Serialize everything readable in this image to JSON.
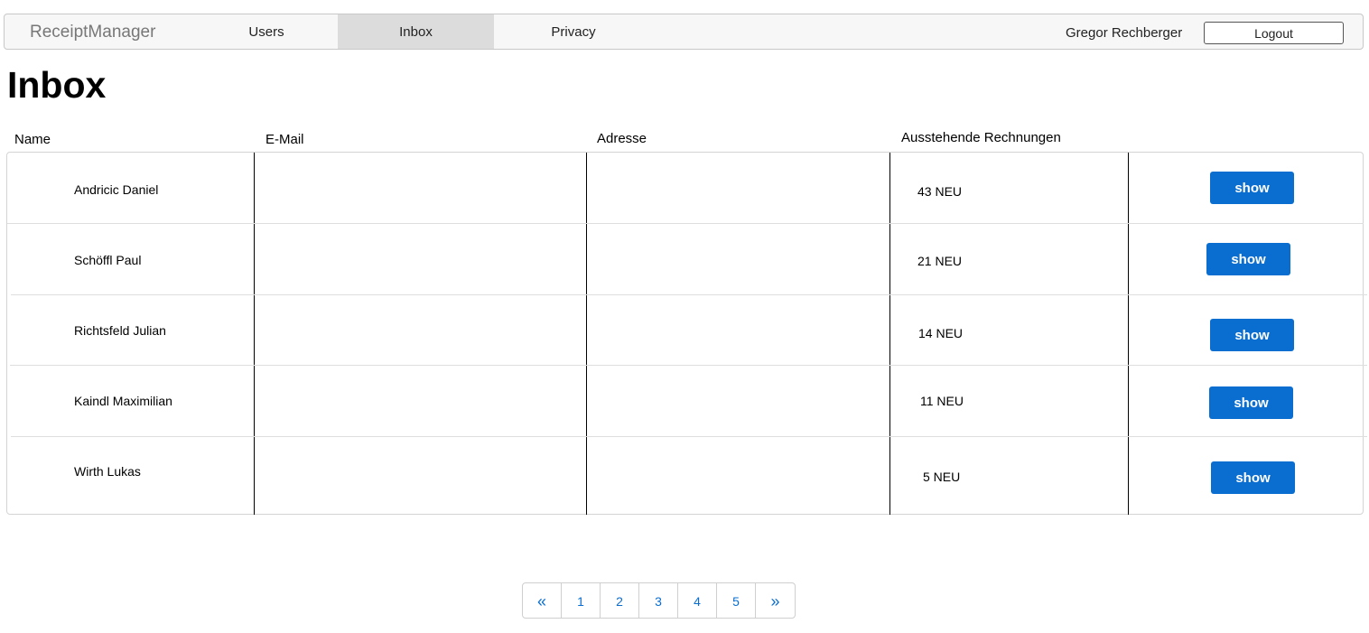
{
  "navbar": {
    "brand": "ReceiptManager",
    "items": [
      {
        "label": "Users",
        "active": false
      },
      {
        "label": "Inbox",
        "active": true
      },
      {
        "label": "Privacy",
        "active": false
      }
    ],
    "user_name": "Gregor Rechberger",
    "logout_label": "Logout"
  },
  "page": {
    "title": "Inbox"
  },
  "table": {
    "columns": [
      "Name",
      "E-Mail",
      "Adresse",
      "Ausstehende Rechnungen"
    ],
    "rows": [
      {
        "name": "Andricic Daniel",
        "email": "",
        "address": "",
        "pending": "43 NEU",
        "action": "show"
      },
      {
        "name": "Schöffl Paul",
        "email": "",
        "address": "",
        "pending": "21 NEU",
        "action": "show"
      },
      {
        "name": "Richtsfeld Julian",
        "email": "",
        "address": "",
        "pending": "14 NEU",
        "action": "show"
      },
      {
        "name": "Kaindl Maximilian",
        "email": "",
        "address": "",
        "pending": "11 NEU",
        "action": "show"
      },
      {
        "name": "Wirth Lukas",
        "email": "",
        "address": "",
        "pending": "5 NEU",
        "action": "show"
      }
    ]
  },
  "pagination": {
    "prev": "«",
    "pages": [
      "1",
      "2",
      "3",
      "4",
      "5"
    ],
    "next": "»"
  },
  "colors": {
    "accent": "#0a6ed1",
    "nav_active_bg": "#dcdcdc",
    "nav_bg": "#f7f7f7"
  }
}
